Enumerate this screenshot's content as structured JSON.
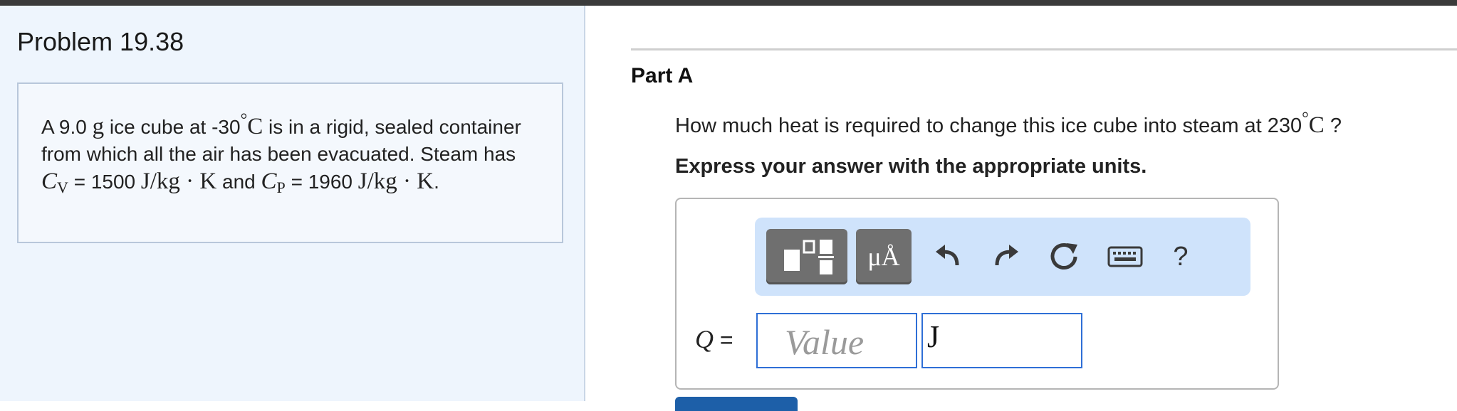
{
  "problem": {
    "title": "Problem 19.38",
    "text": {
      "t1": "A 9.0",
      "g": "g",
      "t2": "ice cube at -30",
      "deg": "°",
      "C": "C",
      "t3": "is in a rigid, sealed container from which all the air has been evacuated. Steam has",
      "cv_sym": "C",
      "cv_sub": "V",
      "t4": "= 1500",
      "unit1": "J/kg · K",
      "t5": "and",
      "cp_sym": "C",
      "cp_sub": "P",
      "t6": "= 1960",
      "unit2": "J/kg · K",
      "t7": "."
    }
  },
  "part": {
    "title": "Part A",
    "question_before": "How much heat is required to change this ice cube into steam at 230",
    "question_deg": "°",
    "question_C": "C",
    "question_after": "?",
    "instruction": "Express your answer with the appropriate units."
  },
  "toolbar": {
    "units_label": "μÅ",
    "help_label": "?",
    "icons": [
      "templates-icon",
      "units-icon",
      "undo-icon",
      "redo-icon",
      "reset-icon",
      "keyboard-icon",
      "help-icon"
    ]
  },
  "answer": {
    "variable": "Q",
    "equals": "=",
    "value_placeholder": "Value",
    "unit_value": "J"
  }
}
